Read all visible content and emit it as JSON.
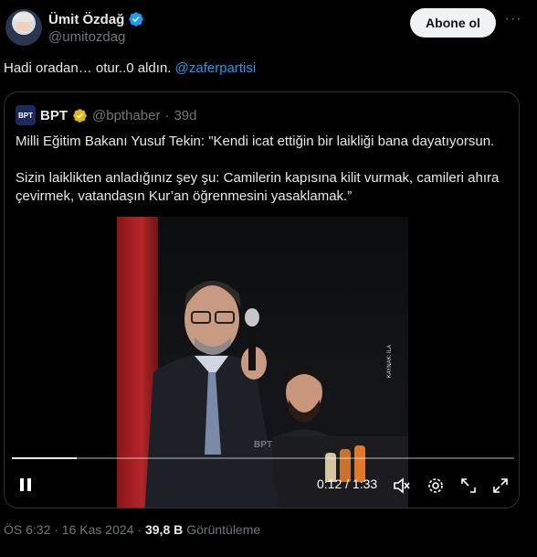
{
  "author": {
    "name": "Ümit Özdağ",
    "handle": "@umitozdag",
    "follow_label": "Abone ol"
  },
  "tweet": {
    "text": "Hadi oradan… otur..0 aldın. ",
    "mention": "@zaferpartisi"
  },
  "quote": {
    "logo_text": "BPT",
    "name": "BPT",
    "handle": "@bpthaber",
    "separator": "·",
    "age": "39d",
    "text": "Milli Eğitim Bakanı Yusuf Tekin: \"Kendi icat ettiğin bir laikliği bana dayatıyorsun.\n\nSizin laiklikten anladığınız şey şu: Camilerin kapısına kilit vurmak, camileri ahıra çevirmek, vatandaşın Kur’an öğrenmesini yasaklamak.”"
  },
  "video": {
    "time": "0:12 / 1:33",
    "progress": 0.129,
    "source_caption": "KAYNAK: İLA",
    "watermark": "BPT"
  },
  "meta": {
    "time": "ÖS 6:32 · 16 Kas 2024 ·",
    "views": "39,8 B",
    "views_label": "Görüntüleme"
  },
  "colors": {
    "accent": "#1d9bf0",
    "verified_blue": "#1d9bf0",
    "verified_gold": "#e2b719"
  },
  "icons": [
    "verified-badge-icon",
    "more-icon",
    "gold-check-icon",
    "pause-icon",
    "mute-icon",
    "settings-icon",
    "minimize-icon",
    "fullscreen-icon"
  ]
}
